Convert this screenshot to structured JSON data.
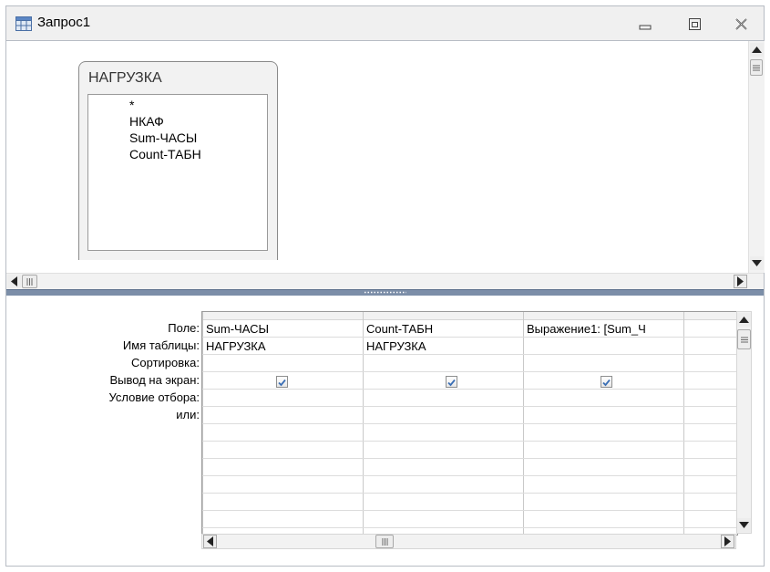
{
  "window": {
    "title": "Запрос1",
    "icon": "query-icon",
    "buttons": [
      "minimize-icon",
      "restore-icon",
      "close-icon"
    ]
  },
  "table_panel": {
    "table_name": "НАГРУЗКА",
    "fields": [
      "*",
      "НКАФ",
      "Sum-ЧАСЫ",
      "Count-ТАБН"
    ]
  },
  "grid": {
    "row_labels": [
      "Поле:",
      "Имя таблицы:",
      "Сортировка:",
      "Вывод на экран:",
      "Условие отбора:",
      "или:"
    ],
    "columns": [
      {
        "field": "Sum-ЧАСЫ",
        "table": "НАГРУЗКА",
        "sort": "",
        "show": true,
        "criteria": "",
        "or": ""
      },
      {
        "field": "Count-ТАБН",
        "table": "НАГРУЗКА",
        "sort": "",
        "show": true,
        "criteria": "",
        "or": ""
      },
      {
        "field": "Выражение1: [Sum_Ч",
        "table": "",
        "sort": "",
        "show": true,
        "criteria": "",
        "or": ""
      },
      {
        "field": "",
        "table": "",
        "sort": "",
        "show": false,
        "criteria": "",
        "or": ""
      }
    ]
  },
  "colors": {
    "splitter": "#7c8ea8",
    "check": "#3b6fb5"
  }
}
